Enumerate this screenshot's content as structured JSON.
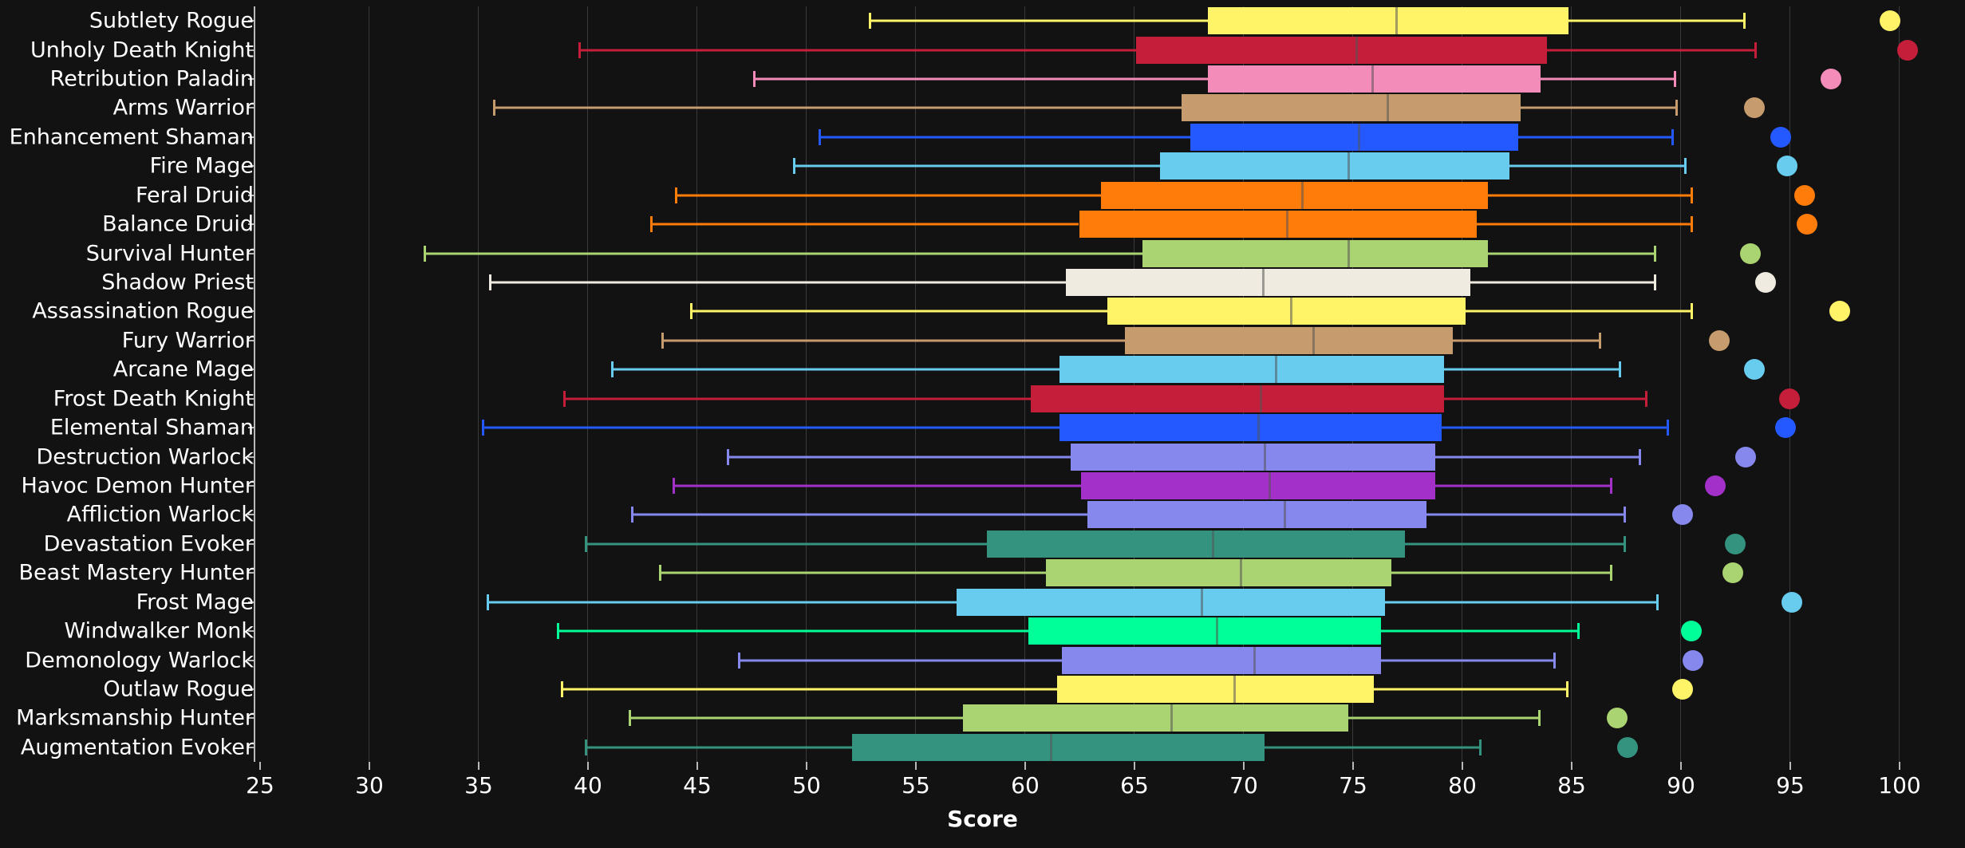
{
  "chart_data": {
    "type": "boxplot",
    "title": "",
    "xlabel": "Score",
    "ylabel": "",
    "xlim": [
      25,
      101.5
    ],
    "xticks": [
      25,
      30,
      35,
      40,
      45,
      50,
      55,
      60,
      65,
      70,
      75,
      80,
      85,
      90,
      95,
      100
    ],
    "grid": "vertical",
    "background": "#121212",
    "axis_color": "#b9b9b9",
    "grid_color": "#3a3a3a",
    "text_color": "#ffffff",
    "categories": [
      "Subtlety Rogue",
      "Unholy Death Knight",
      "Retribution Paladin",
      "Arms Warrior",
      "Enhancement Shaman",
      "Fire Mage",
      "Feral Druid",
      "Balance Druid",
      "Survival Hunter",
      "Shadow Priest",
      "Assassination Rogue",
      "Fury Warrior",
      "Arcane Mage",
      "Frost Death Knight",
      "Elemental Shaman",
      "Destruction Warlock",
      "Havoc Demon Hunter",
      "Affliction Warlock",
      "Devastation Evoker",
      "Beast Mastery Hunter",
      "Frost Mage",
      "Windwalker Monk",
      "Demonology Warlock",
      "Outlaw Rogue",
      "Marksmanship Hunter",
      "Augmentation Evoker"
    ],
    "boxes": [
      {
        "label": "Subtlety Rogue",
        "color": "#fff468",
        "whisker_low": 52.9,
        "q1": 68.4,
        "median": 77.0,
        "q3": 84.9,
        "whisker_high": 93.0,
        "outlier": 99.6
      },
      {
        "label": "Unholy Death Knight",
        "color": "#c41e3a",
        "whisker_low": 39.6,
        "q1": 65.1,
        "median": 75.2,
        "q3": 83.9,
        "whisker_high": 93.5,
        "outlier": 100.4
      },
      {
        "label": "Retribution Paladin",
        "color": "#f48cba",
        "whisker_low": 47.6,
        "q1": 68.4,
        "median": 75.9,
        "q3": 83.6,
        "whisker_high": 89.8,
        "outlier": 96.9
      },
      {
        "label": "Arms Warrior",
        "color": "#c69b6d",
        "whisker_low": 35.7,
        "q1": 67.2,
        "median": 76.6,
        "q3": 82.7,
        "whisker_high": 89.9,
        "outlier": 93.4
      },
      {
        "label": "Enhancement Shaman",
        "color": "#2459ff",
        "whisker_low": 50.6,
        "q1": 67.6,
        "median": 75.3,
        "q3": 82.6,
        "whisker_high": 89.7,
        "outlier": 94.6
      },
      {
        "label": "Fire Mage",
        "color": "#68ccef",
        "whisker_low": 49.4,
        "q1": 66.2,
        "median": 74.8,
        "q3": 82.2,
        "whisker_high": 90.3,
        "outlier": 94.9
      },
      {
        "label": "Feral Druid",
        "color": "#ff7c0a",
        "whisker_low": 44.0,
        "q1": 63.5,
        "median": 72.7,
        "q3": 81.2,
        "whisker_high": 90.6,
        "outlier": 95.7
      },
      {
        "label": "Balance Druid",
        "color": "#ff7c0a",
        "whisker_low": 42.9,
        "q1": 62.5,
        "median": 72.0,
        "q3": 80.7,
        "whisker_high": 90.6,
        "outlier": 95.8
      },
      {
        "label": "Survival Hunter",
        "color": "#aad372",
        "whisker_low": 32.5,
        "q1": 65.4,
        "median": 74.8,
        "q3": 81.2,
        "whisker_high": 88.9,
        "outlier": 93.2
      },
      {
        "label": "Shadow Priest",
        "color": "#f0ebe0",
        "whisker_low": 35.5,
        "q1": 61.9,
        "median": 70.9,
        "q3": 80.4,
        "whisker_high": 88.9,
        "outlier": 93.9
      },
      {
        "label": "Assassination Rogue",
        "color": "#fff468",
        "whisker_low": 44.7,
        "q1": 63.8,
        "median": 72.2,
        "q3": 80.2,
        "whisker_high": 90.6,
        "outlier": 97.3
      },
      {
        "label": "Fury Warrior",
        "color": "#c69b6d",
        "whisker_low": 43.4,
        "q1": 64.6,
        "median": 73.2,
        "q3": 79.6,
        "whisker_high": 86.4,
        "outlier": 91.8
      },
      {
        "label": "Arcane Mage",
        "color": "#68ccef",
        "whisker_low": 41.1,
        "q1": 61.6,
        "median": 71.5,
        "q3": 79.2,
        "whisker_high": 87.3,
        "outlier": 93.4
      },
      {
        "label": "Frost Death Knight",
        "color": "#c41e3a",
        "whisker_low": 38.9,
        "q1": 60.3,
        "median": 70.8,
        "q3": 79.2,
        "whisker_high": 88.5,
        "outlier": 95.0
      },
      {
        "label": "Elemental Shaman",
        "color": "#2459ff",
        "whisker_low": 35.2,
        "q1": 61.6,
        "median": 70.7,
        "q3": 79.1,
        "whisker_high": 89.5,
        "outlier": 94.8
      },
      {
        "label": "Destruction Warlock",
        "color": "#8788ee",
        "whisker_low": 46.4,
        "q1": 62.1,
        "median": 71.0,
        "q3": 78.8,
        "whisker_high": 88.2,
        "outlier": 93.0
      },
      {
        "label": "Havoc Demon Hunter",
        "color": "#a330c9",
        "whisker_low": 43.9,
        "q1": 62.6,
        "median": 71.2,
        "q3": 78.8,
        "whisker_high": 86.9,
        "outlier": 91.6
      },
      {
        "label": "Affliction Warlock",
        "color": "#8788ee",
        "whisker_low": 42.0,
        "q1": 62.9,
        "median": 71.9,
        "q3": 78.4,
        "whisker_high": 87.5,
        "outlier": 90.1
      },
      {
        "label": "Devastation Evoker",
        "color": "#33937f",
        "whisker_low": 39.9,
        "q1": 58.3,
        "median": 68.6,
        "q3": 77.4,
        "whisker_high": 87.5,
        "outlier": 92.5
      },
      {
        "label": "Beast Mastery Hunter",
        "color": "#aad372",
        "whisker_low": 43.3,
        "q1": 61.0,
        "median": 69.9,
        "q3": 76.8,
        "whisker_high": 86.9,
        "outlier": 92.4
      },
      {
        "label": "Frost Mage",
        "color": "#68ccef",
        "whisker_low": 35.4,
        "q1": 56.9,
        "median": 68.1,
        "q3": 76.5,
        "whisker_high": 89.0,
        "outlier": 95.1
      },
      {
        "label": "Windwalker Monk",
        "color": "#00ff98",
        "whisker_low": 38.6,
        "q1": 60.2,
        "median": 68.8,
        "q3": 76.3,
        "whisker_high": 85.4,
        "outlier": 90.5
      },
      {
        "label": "Demonology Warlock",
        "color": "#8788ee",
        "whisker_low": 46.9,
        "q1": 61.7,
        "median": 70.5,
        "q3": 76.3,
        "whisker_high": 84.3,
        "outlier": 90.6
      },
      {
        "label": "Outlaw Rogue",
        "color": "#fff468",
        "whisker_low": 38.8,
        "q1": 61.5,
        "median": 69.6,
        "q3": 76.0,
        "whisker_high": 84.9,
        "outlier": 90.1
      },
      {
        "label": "Marksmanship Hunter",
        "color": "#aad372",
        "whisker_low": 41.9,
        "q1": 57.2,
        "median": 66.7,
        "q3": 74.8,
        "whisker_high": 83.6,
        "outlier": 87.1
      },
      {
        "label": "Augmentation Evoker",
        "color": "#33937f",
        "whisker_low": 39.9,
        "q1": 52.1,
        "median": 61.2,
        "q3": 71.0,
        "whisker_high": 80.9,
        "outlier": 87.6
      }
    ]
  }
}
